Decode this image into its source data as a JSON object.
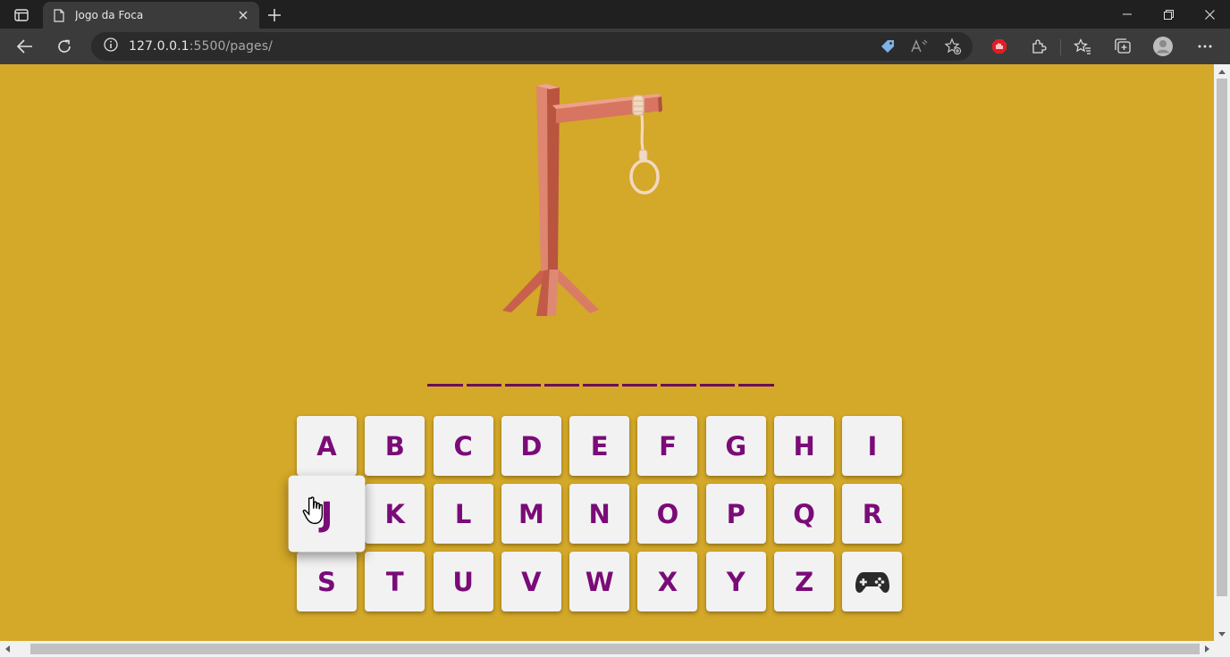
{
  "browser": {
    "tab_title": "Jogo da Foca",
    "url_host": "127.0.0.1",
    "url_rest": ":5500/pages/"
  },
  "game": {
    "word_slots": 9,
    "keyboard": {
      "letters": [
        "A",
        "B",
        "C",
        "D",
        "E",
        "F",
        "G",
        "H",
        "I",
        "J",
        "K",
        "L",
        "M",
        "N",
        "O",
        "P",
        "Q",
        "R",
        "S",
        "T",
        "U",
        "V",
        "W",
        "X",
        "Y",
        "Z"
      ],
      "hovered_key": "J",
      "new_game_icon": "gamepad-icon"
    }
  },
  "colors": {
    "page_background": "#d4a828",
    "key_text": "#7a0b78",
    "word_underline": "#6a0f59",
    "gallows_wood": "#d2705a"
  }
}
